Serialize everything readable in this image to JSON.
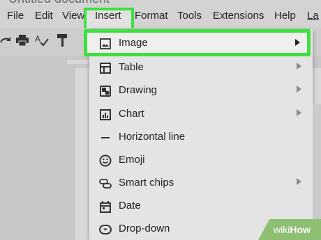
{
  "doc_title": "Untitled document",
  "menubar": {
    "items": [
      "File",
      "Edit",
      "View",
      "Insert",
      "Format",
      "Tools",
      "Extensions",
      "Help",
      "La"
    ],
    "highlight_color": "#3de13d"
  },
  "toolbar": {
    "icons": [
      "redo-icon",
      "print-icon",
      "spellcheck-icon",
      "paint-format-icon"
    ]
  },
  "insert_menu": {
    "items": [
      {
        "label": "Image",
        "icon": "image-icon",
        "has_submenu": true
      },
      {
        "label": "Table",
        "icon": "table-icon",
        "has_submenu": true
      },
      {
        "label": "Drawing",
        "icon": "drawing-icon",
        "has_submenu": true
      },
      {
        "label": "Chart",
        "icon": "chart-icon",
        "has_submenu": true
      },
      {
        "label": "Horizontal line",
        "icon": "horizontal-line-icon",
        "has_submenu": false
      },
      {
        "label": "Emoji",
        "icon": "emoji-icon",
        "has_submenu": false
      },
      {
        "label": "Smart chips",
        "icon": "smart-chips-icon",
        "has_submenu": true
      },
      {
        "label": "Date",
        "icon": "date-icon",
        "has_submenu": false
      },
      {
        "label": "Drop-down",
        "icon": "dropdown-icon",
        "has_submenu": false
      }
    ]
  },
  "watermark": {
    "wiki": "wiki",
    "how": "How"
  }
}
